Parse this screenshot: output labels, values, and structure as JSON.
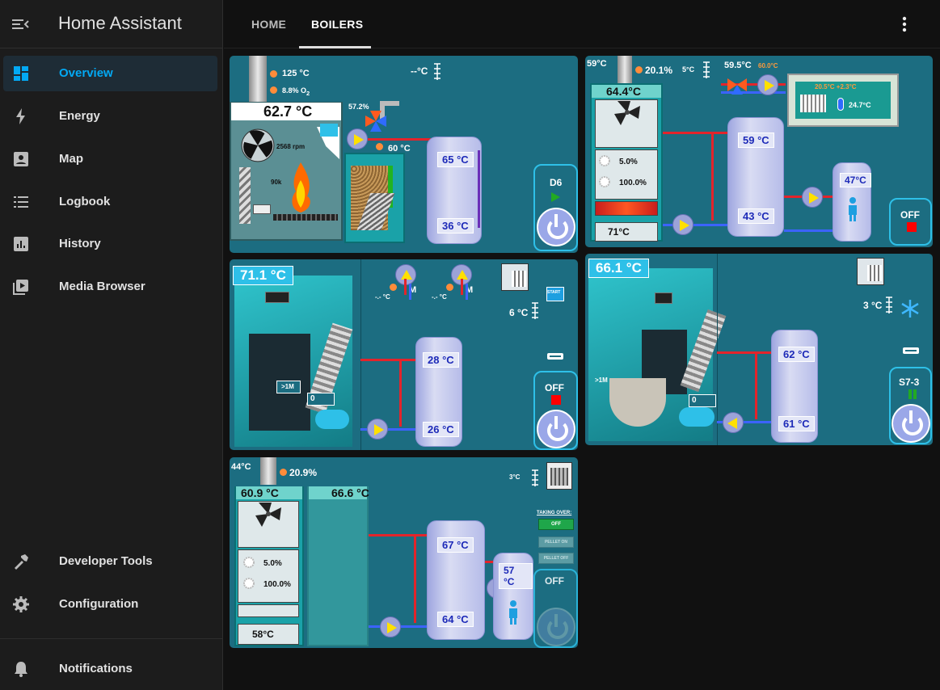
{
  "app": {
    "title": "Home Assistant"
  },
  "nav": [
    {
      "label": "Overview",
      "icon": "dashboard-icon",
      "selected": true
    },
    {
      "label": "Energy",
      "icon": "lightning-icon"
    },
    {
      "label": "Map",
      "icon": "account-box-icon"
    },
    {
      "label": "Logbook",
      "icon": "list-icon"
    },
    {
      "label": "History",
      "icon": "chart-box-icon"
    },
    {
      "label": "Media Browser",
      "icon": "play-box-icon"
    }
  ],
  "nav_bottom": [
    {
      "label": "Developer Tools",
      "icon": "hammer-icon"
    },
    {
      "label": "Configuration",
      "icon": "gear-icon"
    },
    {
      "label": "Notifications",
      "icon": "bell-icon"
    }
  ],
  "tabs": [
    {
      "label": "HOME"
    },
    {
      "label": "BOILERS",
      "selected": true
    }
  ],
  "colors": {
    "accent": "#03a9f4",
    "card": "#1c6d81",
    "pipe_hot": "#e3242b",
    "pipe_cold": "#3c63ff",
    "status_red": "#ff0000",
    "status_green": "#22aa22"
  },
  "card1": {
    "flue_temp": "125 °C",
    "o2": "8.8% O",
    "o2_sub": "2",
    "outdoor": "--°C",
    "boiler_temp": "62.7 °C",
    "fan_rpm": "2568 rpm",
    "valve": "57.2%",
    "supply": "60 °C",
    "fire_label": "90k",
    "tank_top": "65 °C",
    "tank_bottom": "36 °C",
    "mode": "D6"
  },
  "card2": {
    "flue": "59°C",
    "o2": "20.1%",
    "outdoor": "5°C",
    "mix_temp": "59.5°C",
    "mix_set": "60.0°C",
    "boiler_temp": "64.4°C",
    "fan_pct": "5.0%",
    "pump_pct": "100.0%",
    "return_temp": "71°C",
    "tank_top": "59 °C",
    "tank_bottom": "43 °C",
    "dhw": "47°C",
    "room_set": "20.5°C +2.3°C",
    "room": "24.7°C",
    "status": "OFF"
  },
  "card3": {
    "boiler_temp": "71.1 °C",
    "mix1_temp": "-.- °C",
    "mix2_temp": "-.- °C",
    "mix_label": "M",
    "start": "START",
    "outdoor": "6 °C",
    "rank": ">1M",
    "counter": "0",
    "tank_top": "28 °C",
    "tank_bottom": "26 °C",
    "status": "OFF"
  },
  "card4": {
    "boiler_temp": "66.1 °C",
    "outdoor": "3 °C",
    "rank": ">1M",
    "counter": "0",
    "tank_top": "62 °C",
    "tank_bottom": "61 °C",
    "mode": "S7-3"
  },
  "card5": {
    "flue": "44°C",
    "o2": "20.9%",
    "outdoor": "3°C",
    "boiler1_temp": "60.9 °C",
    "boiler2_temp": "66.6 °C",
    "fan_pct": "5.0%",
    "pump_pct": "100.0%",
    "return_temp": "58°C",
    "tank_top": "67 °C",
    "tank_bottom": "64 °C",
    "dhw": "57 °C",
    "taking_over": "TAKING OVER:",
    "btn_off": "OFF",
    "btn_pellet_on": "PELLET ON",
    "btn_pellet_off": "PELLET OFF",
    "status": "OFF"
  }
}
